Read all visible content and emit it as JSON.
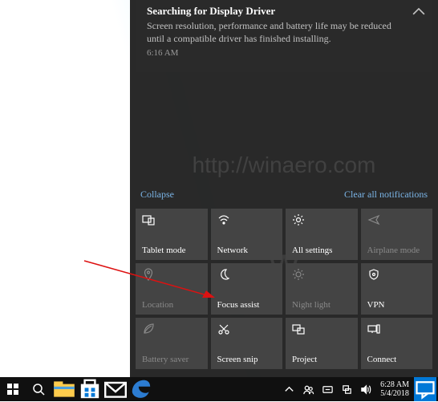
{
  "notification": {
    "title": "Searching for Display Driver",
    "body": "Screen resolution, performance and battery life may be reduced until a compatible driver has finished installing.",
    "time": "6:16 AM"
  },
  "watermark": "http://winaero.com",
  "action_center": {
    "collapse": "Collapse",
    "clear": "Clear all notifications",
    "tiles": [
      {
        "label": "Tablet mode",
        "icon": "tablet"
      },
      {
        "label": "Network",
        "icon": "wifi"
      },
      {
        "label": "All settings",
        "icon": "gear"
      },
      {
        "label": "Airplane mode",
        "icon": "airplane",
        "dim": true
      },
      {
        "label": "Location",
        "icon": "location",
        "dim": true
      },
      {
        "label": "Focus assist",
        "icon": "moon"
      },
      {
        "label": "Night light",
        "icon": "sun",
        "dim": true
      },
      {
        "label": "VPN",
        "icon": "vpn"
      },
      {
        "label": "Battery saver",
        "icon": "leaf",
        "dim": true
      },
      {
        "label": "Screen snip",
        "icon": "snip"
      },
      {
        "label": "Project",
        "icon": "project"
      },
      {
        "label": "Connect",
        "icon": "connect"
      }
    ]
  },
  "taskbar": {
    "clock_time": "6:28 AM",
    "clock_date": "5/4/2018"
  }
}
